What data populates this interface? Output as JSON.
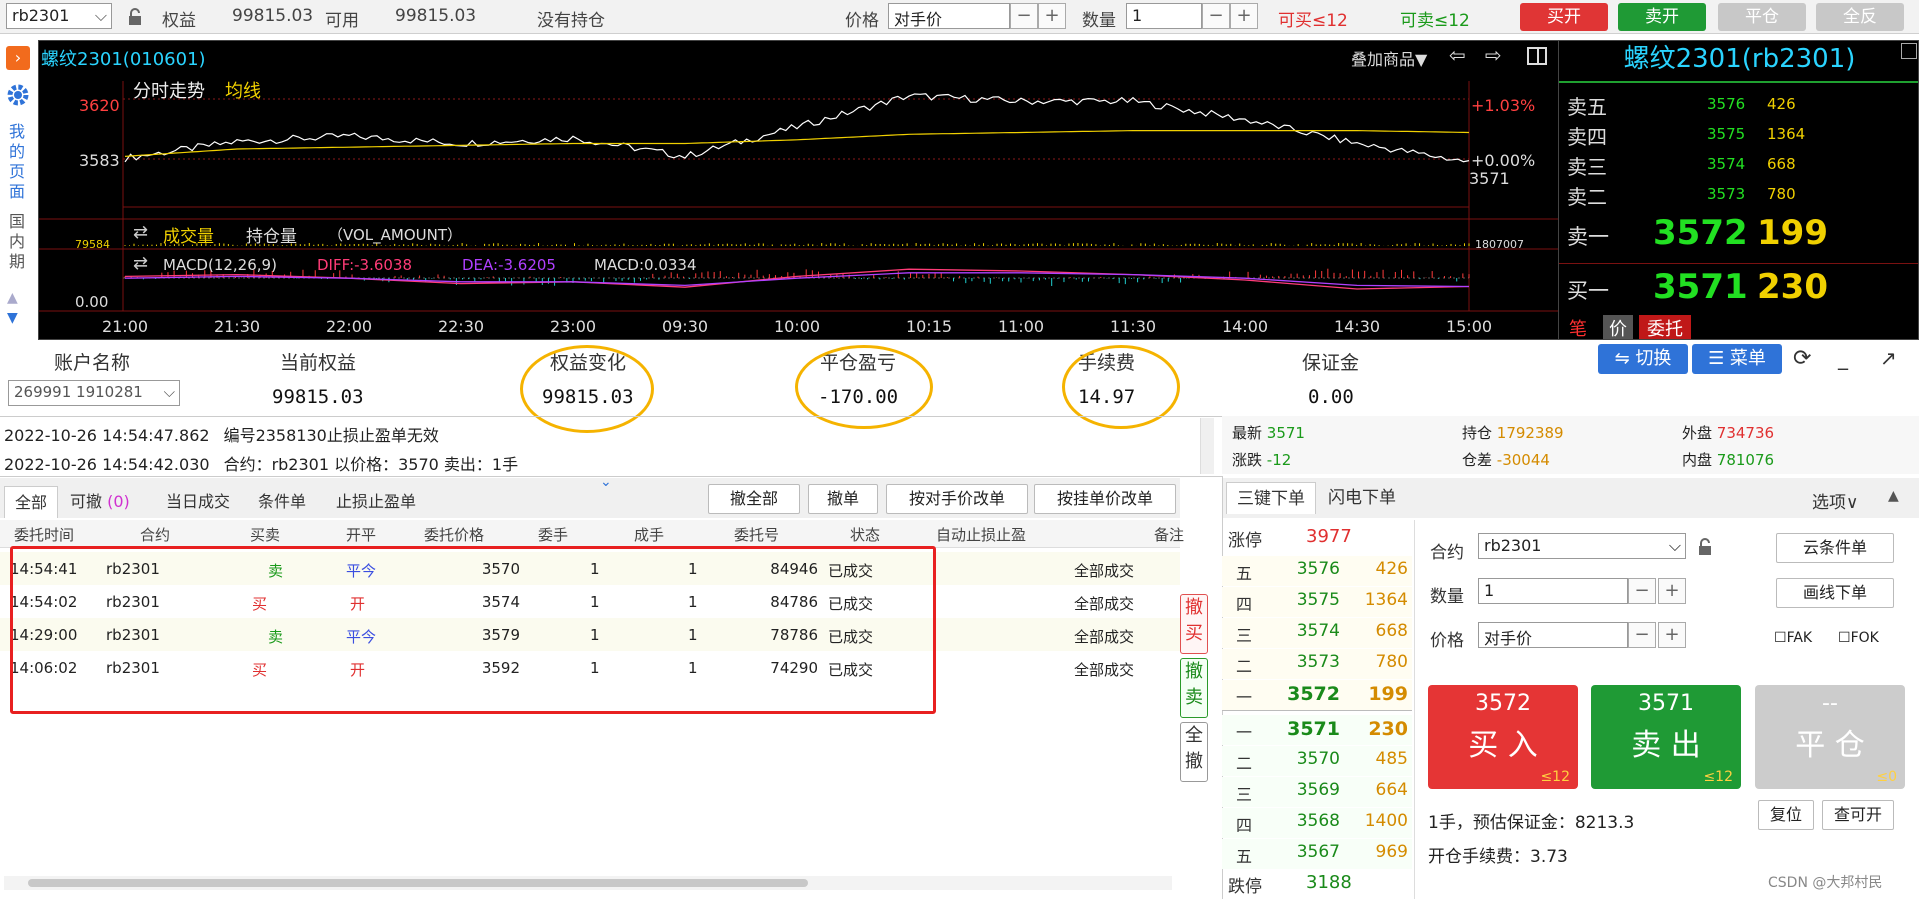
{
  "toolbar": {
    "contract": "rb2301",
    "equity_label": "权益",
    "equity_value": "99815.03",
    "available_label": "可用",
    "available_value": "99815.03",
    "position_status": "没有持仓",
    "price_label": "价格",
    "price_value": "对手价",
    "qty_label": "数量",
    "qty_value": "1",
    "can_buy": "可买≤12",
    "can_sell": "可卖≤12",
    "btn_buy_open": "买开",
    "btn_sell_open": "卖开",
    "btn_close": "平仓",
    "btn_reverse": "全反",
    "minus": "−",
    "plus": "+"
  },
  "sidebar": {
    "my_page": "我的页面",
    "domestic_period": "国内期"
  },
  "chart": {
    "instrument": "螺纹2301(010601)",
    "overlay_label": "叠加商品▼",
    "panel_title": "分时走势",
    "avg_line_label": "均线",
    "y_high": "3620",
    "y_mid": "3583",
    "pct_high": "+1.03%",
    "pct_mid": "+0.00%",
    "last_price_tag": "3571",
    "volume_title": "成交量",
    "oi_title": "持仓量",
    "vol_amount_label": "（VOL_AMOUNT）",
    "vol_left_val": "79584",
    "vol_right_val": "1807007",
    "macd_label": "MACD(12,26,9)",
    "diff_label": "DIFF:-3.6038",
    "dea_label": "DEA:-3.6205",
    "macd_value_label": "MACD:0.0334",
    "macd_zero": "0.00",
    "time_ticks": [
      "21:00",
      "21:30",
      "22:00",
      "22:30",
      "23:00",
      "09:30",
      "10:00",
      "10:15",
      "11:00",
      "11:30",
      "14:00",
      "14:30",
      "15:00"
    ]
  },
  "chart_data": {
    "type": "line",
    "title": "分时走势",
    "x": [
      "21:00",
      "21:30",
      "22:00",
      "22:30",
      "23:00",
      "09:30",
      "10:00",
      "10:15",
      "11:00",
      "11:30",
      "14:00",
      "14:30",
      "15:00"
    ],
    "ylim": [
      3546,
      3620
    ],
    "series": [
      {
        "name": "",
        "values": [
          3578,
          3587,
          3590,
          3586,
          3589,
          3579,
          3595,
          3612,
          3609,
          3609,
          3599,
          3586,
          3576
        ]
      },
      {
        "name": "均线",
        "values": [
          3579,
          3583,
          3584,
          3585,
          3586,
          3586,
          3588,
          3591,
          3592,
          3593,
          3593,
          3593,
          3592
        ]
      }
    ],
    "macd_ylim": [
      -15,
      15
    ],
    "macd_series": [
      {
        "name": "DIFF",
        "values": [
          2,
          3,
          1,
          -2,
          -1,
          -4,
          2,
          6,
          5,
          3,
          0,
          -5,
          -3.6
        ]
      },
      {
        "name": "DEA",
        "values": [
          1,
          2,
          1,
          -1,
          -1,
          -3,
          1,
          4,
          4,
          3,
          1,
          -3,
          -3.6
        ]
      }
    ],
    "colors": {
      "price": "#ffffff",
      "avg": "#f0d000",
      "diff": "#ff3c78",
      "dea": "#b040ff"
    }
  },
  "quote": {
    "title": "螺纹2301(rb2301)",
    "asks": [
      {
        "label": "卖五",
        "price": "3576",
        "qty": "426"
      },
      {
        "label": "卖四",
        "price": "3575",
        "qty": "1364"
      },
      {
        "label": "卖三",
        "price": "3574",
        "qty": "668"
      },
      {
        "label": "卖二",
        "price": "3573",
        "qty": "780"
      }
    ],
    "ask1": {
      "label": "卖一",
      "price": "3572",
      "qty": "199"
    },
    "bid1": {
      "label": "买一",
      "price": "3571",
      "qty": "230"
    },
    "tabs": [
      "笔",
      "价",
      "委托"
    ]
  },
  "account": {
    "headers": [
      "账户名称",
      "当前权益",
      "权益变化",
      "平仓盈亏",
      "手续费",
      "保证金"
    ],
    "name": "269991 1910281",
    "current_equity": "99815.03",
    "equity_change": "99815.03",
    "close_pnl": "-170.00",
    "fee": "14.97",
    "margin": "0.00",
    "switch_btn": "⇋ 切换",
    "menu_btn": "☰ 菜单"
  },
  "logs": [
    {
      "time": "2022-10-26 14:54:47.862",
      "msg": "编号2358130止损止盈单无效"
    },
    {
      "time": "2022-10-26 14:54:42.030",
      "msg": "合约：rb2301 以价格：3570 卖出：1手"
    }
  ],
  "market": {
    "latest_label": "最新",
    "latest": "3571",
    "oi_label": "持仓",
    "oi": "1792389",
    "outer_label": "外盘",
    "outer": "734736",
    "change_label": "涨跌",
    "change": "-12",
    "oi_diff_label": "仓差",
    "oi_diff": "-30044",
    "inner_label": "内盘",
    "inner": "781076"
  },
  "orders": {
    "tabs": {
      "all": "全部",
      "cancelable": "可撤",
      "cancelable_count": "(0)",
      "today": "当日成交",
      "conditional": "条件单",
      "stop": "止损止盈单"
    },
    "actions": [
      "撤全部",
      "撤单",
      "按对手价改单",
      "按挂单价改单"
    ],
    "columns": [
      "委托时间",
      "合约",
      "买卖",
      "开平",
      "委托价格",
      "委手",
      "成手",
      "委托号",
      "状态",
      "自动止损止盈",
      "备注"
    ],
    "rows": [
      {
        "time": "14:54:41",
        "contract": "rb2301",
        "side": "卖",
        "oc": "平今",
        "price": "3570",
        "vol": "1",
        "filled": "1",
        "id": "84946",
        "status": "已成交",
        "note": "全部成交"
      },
      {
        "time": "14:54:02",
        "contract": "rb2301",
        "side": "买",
        "oc": "开",
        "price": "3574",
        "vol": "1",
        "filled": "1",
        "id": "84786",
        "status": "已成交",
        "note": "全部成交"
      },
      {
        "time": "14:29:00",
        "contract": "rb2301",
        "side": "卖",
        "oc": "平今",
        "price": "3579",
        "vol": "1",
        "filled": "1",
        "id": "78786",
        "status": "已成交",
        "note": "全部成交"
      },
      {
        "time": "14:06:02",
        "contract": "rb2301",
        "side": "买",
        "oc": "开",
        "price": "3592",
        "vol": "1",
        "filled": "1",
        "id": "74290",
        "status": "已成交",
        "note": "全部成交"
      }
    ],
    "side_buttons": [
      "撤买",
      "撤卖",
      "全撤"
    ]
  },
  "order_panel": {
    "tab_three_key": "三键下单",
    "tab_flash": "闪电下单",
    "options": "选项∨",
    "limit_up_label": "涨停",
    "limit_up": "3977",
    "limit_down_label": "跌停",
    "limit_down": "3188",
    "asks": [
      {
        "label": "五",
        "price": "3576",
        "qty": "426"
      },
      {
        "label": "四",
        "price": "3575",
        "qty": "1364"
      },
      {
        "label": "三",
        "price": "3574",
        "qty": "668"
      },
      {
        "label": "二",
        "price": "3573",
        "qty": "780"
      },
      {
        "label": "一",
        "price": "3572",
        "qty": "199"
      }
    ],
    "bids": [
      {
        "label": "一",
        "price": "3571",
        "qty": "230"
      },
      {
        "label": "二",
        "price": "3570",
        "qty": "485"
      },
      {
        "label": "三",
        "price": "3569",
        "qty": "664"
      },
      {
        "label": "四",
        "price": "3568",
        "qty": "1400"
      },
      {
        "label": "五",
        "price": "3567",
        "qty": "969"
      }
    ],
    "contract_label": "合约",
    "contract": "rb2301",
    "qty_label": "数量",
    "qty": "1",
    "price_label": "价格",
    "price": "对手价",
    "cloud_btn": "云条件单",
    "draw_btn": "画线下单",
    "fak": "FAK",
    "fok": "FOK",
    "buy_price": "3572",
    "buy_label": "买 入",
    "buy_limit": "≤12",
    "sell_price": "3571",
    "sell_label": "卖 出",
    "sell_limit": "≤12",
    "close_price": "--",
    "close_label": "平 仓",
    "close_limit": "≤0",
    "margin_info": "1手，预估保证金：8213.3",
    "fee_info": "开仓手续费：3.73",
    "reset_btn": "复位",
    "check_btn": "查可开"
  },
  "watermark": "CSDN @大邦村民"
}
